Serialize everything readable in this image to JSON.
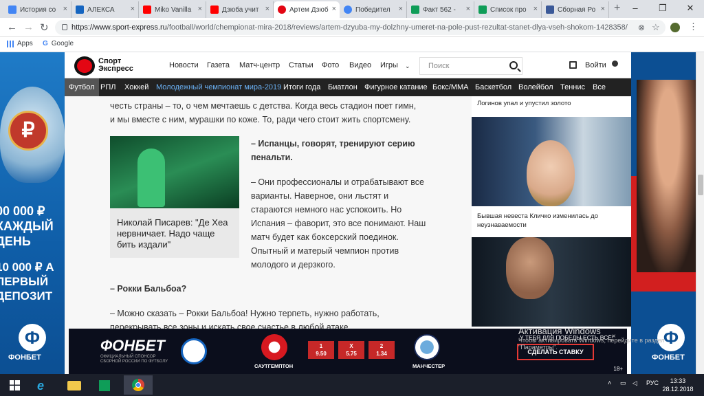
{
  "browser": {
    "tabs": [
      {
        "title": "История со",
        "color": "#4285f4"
      },
      {
        "title": "АЛЕКСА",
        "color": "#1565c0"
      },
      {
        "title": "Miko Vanilla",
        "color": "#ff0000"
      },
      {
        "title": "Дзюба учит",
        "color": "#ff0000"
      },
      {
        "title": "Артем Дзюб",
        "color": "#e30613"
      },
      {
        "title": "Победител",
        "color": "#4285f4"
      },
      {
        "title": "Факт 562 -",
        "color": "#0f9d58"
      },
      {
        "title": "Список про",
        "color": "#0f9d58"
      },
      {
        "title": "Сборная Ро",
        "color": "#3b5998"
      }
    ],
    "url_host": "https://www.sport-express.ru",
    "url_path": "/football/world/chempionat-mira-2018/reviews/artem-dzyuba-my-dolzhny-umeret-na-pole-pust-rezultat-stanet-dlya-vseh-shokom-1428358/",
    "bookmarks": [
      "Apps",
      "Google"
    ]
  },
  "site": {
    "logo": [
      "Спорт",
      "Экспресс"
    ],
    "nav": [
      "Новости",
      "Газета",
      "Матч-центр",
      "Статьи",
      "Фото",
      "Видео",
      "Игры"
    ],
    "search_placeholder": "Поиск",
    "login": "Войти",
    "sports": [
      "Футбол",
      "РПЛ",
      "Хоккей",
      "Молодежный чемпионат мира-2019",
      "Итоги года",
      "Биатлон",
      "Фигурное катание",
      "Бокс/ММА",
      "Баскетбол",
      "Волейбол",
      "Теннис",
      "Все"
    ]
  },
  "article": {
    "intro": "честь страны – то, о чем мечтаешь с детства. Когда весь стадион поет гимн, и мы вместе с ним, мурашки по коже. То, ради чего стоит жить спортсмену.",
    "card_title": "Николай Писарев: \"Де Хеа нервничает. Надо чаще бить издали\"",
    "question1": "– Испанцы, говорят, тренируют серию пенальти.",
    "answer1": "– Они профессионалы и отрабатывают все варианты. Наверное, они льстят и стараются немного нас успокоить. Но Испания – фаворит, это все понимают. Наш матч будет как боксерский поединок. Опытный и матерый чемпион против молодого и дерзкого.",
    "question2": "– Рокки Бальбоа?",
    "answer2": "– Можно сказать – Рокки Бальбоа! Нужно терпеть, нужно работать, перекрывать все зоны и искать свое счастье в любой атаке."
  },
  "sidebar": {
    "news1": "Логинов упал и упустил золото",
    "news2": "Бывшая невеста Кличко изменилась до неузнаваемости"
  },
  "ads": {
    "left_line1": "00 000 ₽ КАЖДЫЙ ДЕНЬ",
    "left_line2": "10 000 ₽ А ПЕРВЫЙ ДЕПОЗИТ",
    "fonbet": "ФОНБЕТ",
    "bottom_logo": "ФОНБЕТ",
    "bottom_sub": "ОФИЦИАЛЬНЫЙ СПОНСОР СБОРНОЙ РОССИИ ПО ФУТБОЛУ",
    "team1": "САУТГЕМПТОН",
    "team2": "МАНЧЕСТЕР",
    "odds": [
      {
        "label": "1",
        "value": "9.50"
      },
      {
        "label": "X",
        "value": "5.75"
      },
      {
        "label": "2",
        "value": "1.34"
      }
    ],
    "cta_text": "У ТЕБЯ ДЛЯ ПОБЕДЫ ЕСТЬ ВСЁ!",
    "cta_button": "СДЕЛАТЬ СТАВКУ",
    "age": "18+"
  },
  "activation": {
    "line1": "Активация Windows",
    "line2": "Чтобы активировать Windows, перейдите в раздел \"Параметры\"."
  },
  "taskbar": {
    "lang": "РУС",
    "time": "13:33",
    "date": "28.12.2018"
  }
}
